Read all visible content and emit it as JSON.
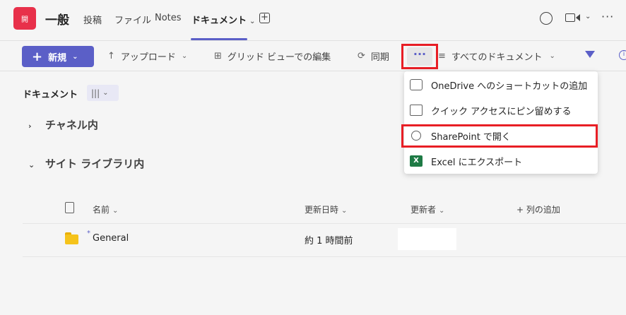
{
  "header": {
    "team_avatar_text": "開",
    "channel_title": "一般",
    "tabs": [
      {
        "label": "投稿"
      },
      {
        "label": "ファイル"
      },
      {
        "label": "Notes"
      },
      {
        "label": "ドキュメント"
      }
    ],
    "add_tab_glyph": "+",
    "more_glyph": "···"
  },
  "toolbar": {
    "new_label": "新規",
    "upload_label": "アップロード",
    "grid_edit_label": "グリッド ビューでの編集",
    "sync_label": "同期",
    "more_glyph": "···",
    "view_label": "すべてのドキュメント"
  },
  "library": {
    "breadcrumb": "ドキュメント",
    "groups": [
      {
        "label": "チャネル内",
        "caret": "›"
      },
      {
        "label": "サイト ライブラリ内",
        "caret": "⌄"
      }
    ],
    "columns": {
      "name": "名前",
      "modified": "更新日時",
      "modified_by": "更新者",
      "add_column": "+ 列の追加"
    },
    "rows": [
      {
        "name": "General",
        "modified": "約 1 時間前"
      }
    ]
  },
  "context_menu": {
    "items": [
      {
        "label": "OneDrive へのショートカットの追加",
        "icon": "shortcut-icon"
      },
      {
        "label": "クイック アクセスにピン留めする",
        "icon": "pin-icon"
      },
      {
        "label": "SharePoint で開く",
        "icon": "sharepoint-icon"
      },
      {
        "label": "Excel にエクスポート",
        "icon": "excel-icon"
      }
    ]
  },
  "colors": {
    "accent": "#5b5fc7",
    "highlight": "#e81e25",
    "avatar": "#e8304a",
    "folder": "#f5c31b",
    "excel": "#1e7a45"
  }
}
